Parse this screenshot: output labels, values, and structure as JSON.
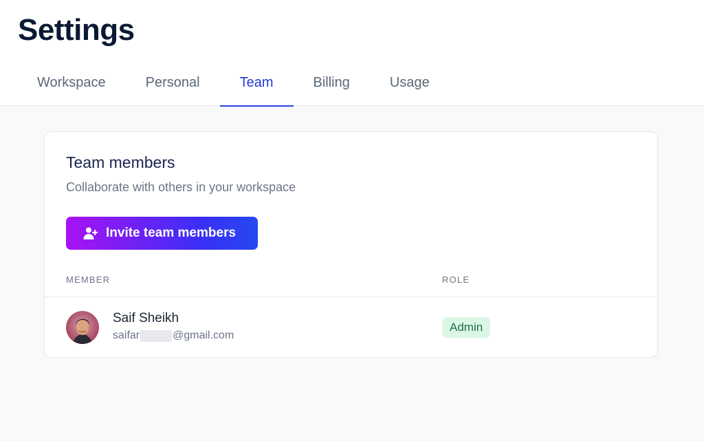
{
  "header": {
    "title": "Settings",
    "tabs": [
      {
        "label": "Workspace",
        "active": false
      },
      {
        "label": "Personal",
        "active": false
      },
      {
        "label": "Team",
        "active": true
      },
      {
        "label": "Billing",
        "active": false
      },
      {
        "label": "Usage",
        "active": false
      }
    ]
  },
  "team_card": {
    "title": "Team members",
    "subtitle": "Collaborate with others in your workspace",
    "invite_button": {
      "label": "Invite team members",
      "icon": "user-plus-icon"
    },
    "columns": {
      "member": "MEMBER",
      "role": "ROLE"
    },
    "members": [
      {
        "name": "Saif Sheikh",
        "email_prefix": "saifar",
        "email_suffix": "@gmail.com",
        "role": "Admin"
      }
    ]
  },
  "colors": {
    "accent": "#2339d8",
    "button_gradient_start": "#a812f4",
    "button_gradient_end": "#2448f2",
    "admin_badge_bg": "#dcf6e6",
    "admin_badge_text": "#1f6f43"
  }
}
